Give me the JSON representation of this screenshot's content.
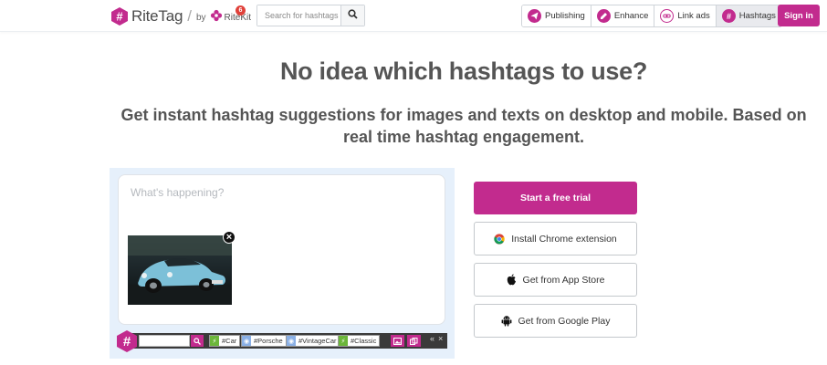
{
  "header": {
    "logo_text": "RiteTag",
    "separator": "/",
    "by_text": "by",
    "ritekit_text": "RiteKit",
    "badge_count": "6",
    "search_placeholder": "Search for hashtags",
    "nav": [
      {
        "label": "Publishing",
        "icon": "paper-plane-icon"
      },
      {
        "label": "Enhance",
        "icon": "pencil-icon"
      },
      {
        "label": "Link ads",
        "icon": "link-icon"
      },
      {
        "label": "Hashtags",
        "icon": "hashtag-icon",
        "active": true
      }
    ],
    "signin_label": "Sign in"
  },
  "hero": {
    "headline": "No idea which hashtags to use?",
    "subline": "Get instant hashtag suggestions for images and texts on desktop and mobile. Based on real time hashtag engagement."
  },
  "demo": {
    "composer_placeholder": "What's happening?",
    "close_label": "×",
    "tags": [
      {
        "label": "#Car",
        "color": "green"
      },
      {
        "label": "#Porsche",
        "color": "blue"
      },
      {
        "label": "#VintageCar",
        "color": "blue"
      },
      {
        "label": "#Classic",
        "color": "green"
      }
    ],
    "controls_collapse": "«",
    "controls_close": "×"
  },
  "cta": {
    "trial_label": "Start a free trial",
    "chrome_label": "Install Chrome extension",
    "appstore_label": "Get from App Store",
    "play_label": "Get from Google Play"
  },
  "colors": {
    "brand": "#c22b8e",
    "demo_bg": "#e6f0fb",
    "text": "#555555"
  }
}
